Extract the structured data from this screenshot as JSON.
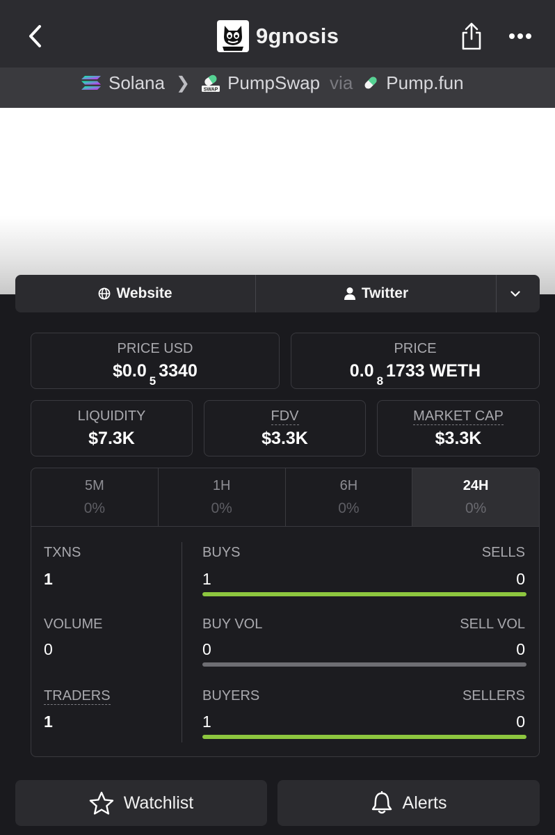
{
  "header": {
    "title": "9gnosis"
  },
  "breadcrumb": {
    "chain": "Solana",
    "dex": "PumpSwap",
    "via": "via",
    "launchpad": "Pump.fun",
    "swap_badge": "SWAP"
  },
  "links": {
    "website": "Website",
    "twitter": "Twitter"
  },
  "prices": {
    "price_usd_label": "PRICE USD",
    "price_usd_prefix": "$0.0",
    "price_usd_zeros": "5",
    "price_usd_digits": "3340",
    "price_label": "PRICE",
    "price_prefix": "0.0",
    "price_zeros": "8",
    "price_digits": "1733 WETH"
  },
  "metrics": {
    "liquidity_label": "LIQUIDITY",
    "liquidity": "$7.3K",
    "fdv_label": "FDV",
    "fdv": "$3.3K",
    "mcap_label": "MARKET CAP",
    "mcap": "$3.3K"
  },
  "timeframes": [
    {
      "label": "5M",
      "change": "0%"
    },
    {
      "label": "1H",
      "change": "0%"
    },
    {
      "label": "6H",
      "change": "0%"
    },
    {
      "label": "24H",
      "change": "0%"
    }
  ],
  "stats": {
    "txns_label": "TXNS",
    "txns": "1",
    "buys_label": "BUYS",
    "buys": "1",
    "sells_label": "SELLS",
    "sells": "0",
    "volume_label": "VOLUME",
    "volume": "0",
    "buy_vol_label": "BUY VOL",
    "buy_vol": "0",
    "sell_vol_label": "SELL VOL",
    "sell_vol": "0",
    "traders_label": "TRADERS",
    "traders": "1",
    "buyers_label": "BUYERS",
    "buyers": "1",
    "sellers_label": "SELLERS",
    "sellers": "0"
  },
  "colors": {
    "buy_bar": "#8dc63f",
    "neutral_bar": "#6e6e73"
  },
  "actions": {
    "watchlist": "Watchlist",
    "alerts": "Alerts"
  }
}
